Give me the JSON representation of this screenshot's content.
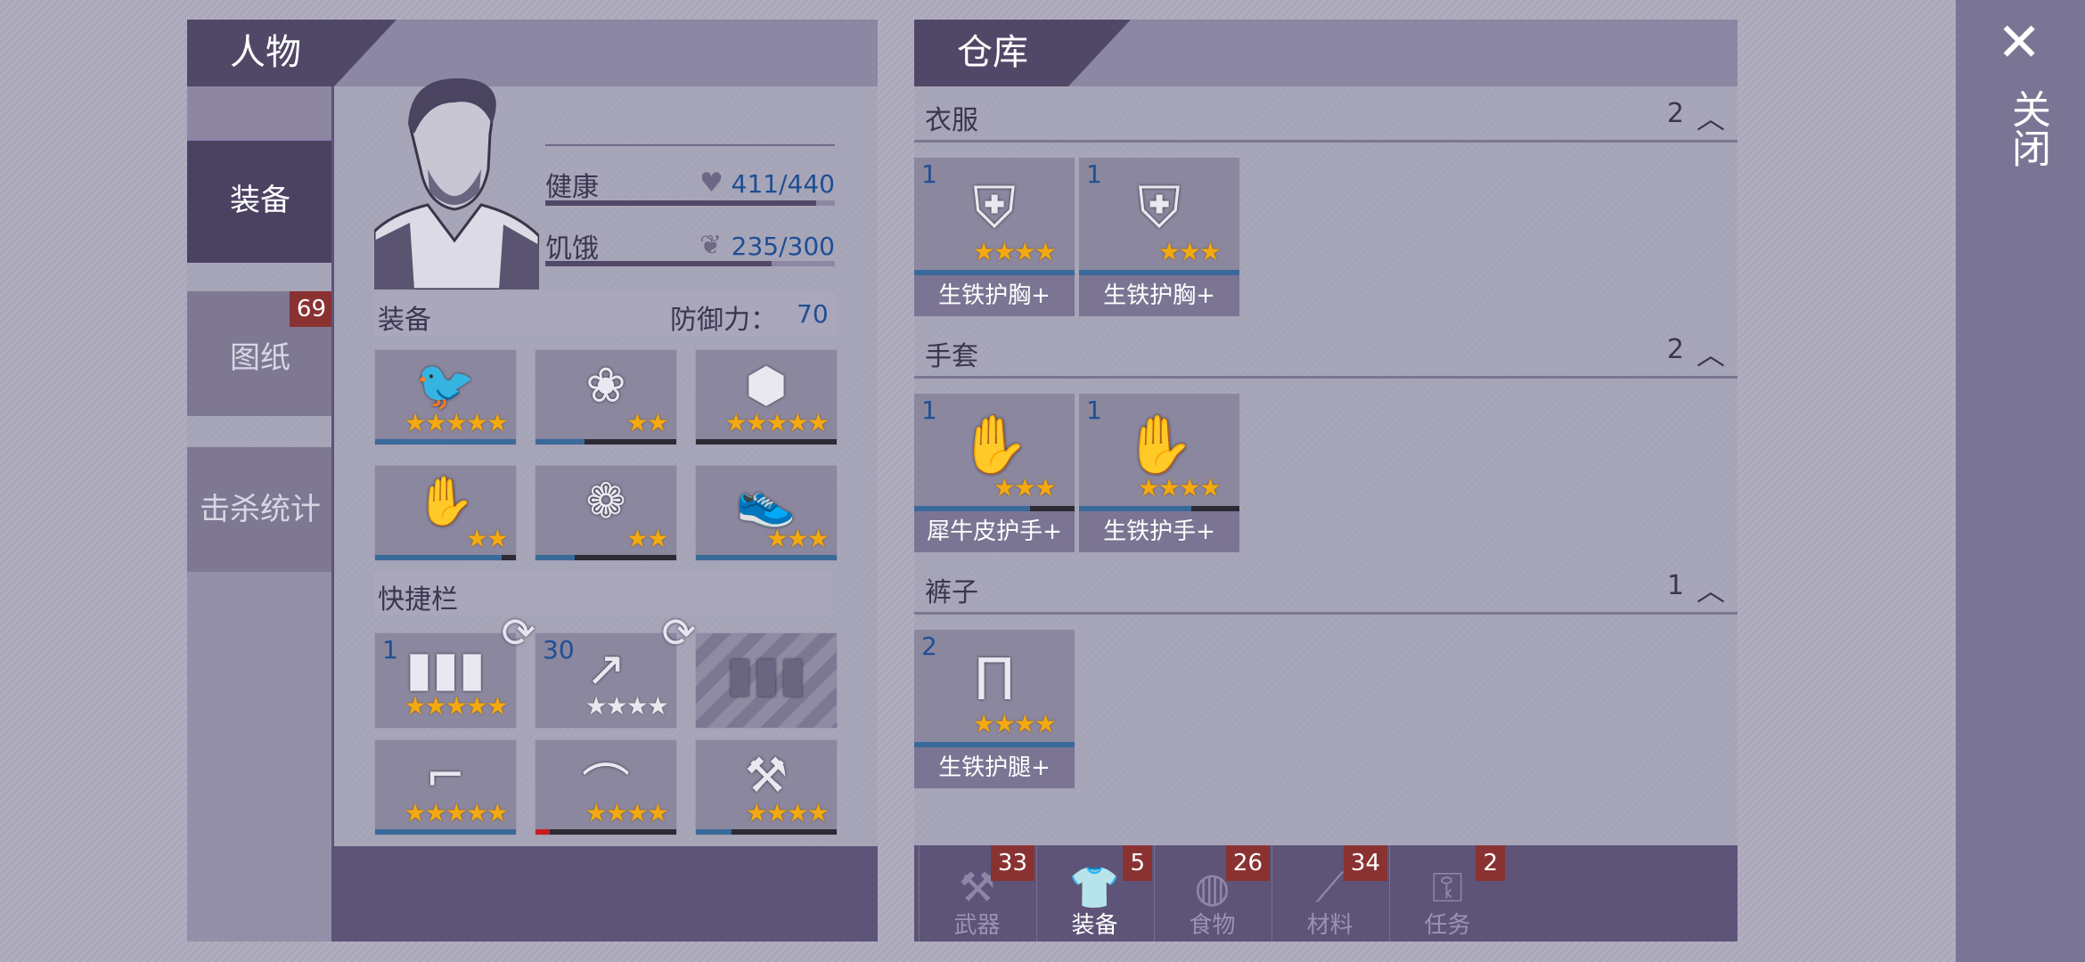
{
  "character_panel": {
    "title": "人物",
    "side_tabs": [
      {
        "label": "装备",
        "active": true
      },
      {
        "label": "图纸",
        "badge": "69"
      },
      {
        "label": "击杀统计"
      }
    ],
    "stats": {
      "health": {
        "label": "健康",
        "value": "411/440",
        "fraction": 0.934,
        "icon": "heart-icon"
      },
      "hunger": {
        "label": "饥饿",
        "value": "235/300",
        "fraction": 0.783,
        "icon": "stomach-icon"
      }
    },
    "equipment": {
      "label": "装备",
      "defense_label": "防御力：",
      "defense_value": "70",
      "slots": [
        {
          "icon": "bird-mask-helmet-icon",
          "stars": 5,
          "durability": 1.0
        },
        {
          "icon": "floral-vest-icon",
          "stars": 2,
          "durability": 0.35
        },
        {
          "icon": "turtle-shell-icon",
          "stars": 5,
          "durability": 0.0
        },
        {
          "icon": "gloves-icon",
          "stars": 2,
          "durability": 0.9
        },
        {
          "icon": "floral-pants-icon",
          "stars": 2,
          "durability": 0.28
        },
        {
          "icon": "sneakers-icon",
          "stars": 3,
          "durability": 1.0
        }
      ]
    },
    "quickbar": {
      "label": "快捷栏",
      "slots": [
        {
          "icon": "bullets-icon",
          "count": "1",
          "stars": 5,
          "swap": true
        },
        {
          "icon": "poison-spear-icon",
          "count": "30",
          "stars": 4,
          "stars_filled": 0,
          "swap": true
        },
        {
          "icon": "empty-ammo-slot-icon",
          "empty": true
        },
        {
          "icon": "revolver-icon",
          "stars": 5,
          "durability": 1.0
        },
        {
          "icon": "bow-icon",
          "stars": 4,
          "durability": 0.1,
          "low": true
        },
        {
          "icon": "axe-icon",
          "stars": 4,
          "durability": 0.25
        }
      ]
    }
  },
  "warehouse": {
    "title": "仓库",
    "categories": [
      {
        "label": "衣服",
        "count": "2",
        "items": [
          {
            "count": "1",
            "name": "生铁护胸+",
            "stars": 4,
            "durability": 1.0,
            "icon": "iron-chestplate-icon"
          },
          {
            "count": "1",
            "name": "生铁护胸+",
            "stars": 3,
            "durability": 1.0,
            "icon": "iron-chestplate-icon"
          }
        ]
      },
      {
        "label": "手套",
        "count": "2",
        "items": [
          {
            "count": "1",
            "name": "犀牛皮护手+",
            "stars": 3,
            "durability": 0.72,
            "icon": "rhino-gloves-icon"
          },
          {
            "count": "1",
            "name": "生铁护手+",
            "stars": 4,
            "durability": 0.7,
            "icon": "iron-gloves-icon"
          }
        ]
      },
      {
        "label": "裤子",
        "count": "1",
        "items": [
          {
            "count": "2",
            "name": "生铁护腿+",
            "stars": 4,
            "durability": 1.0,
            "icon": "iron-leggings-icon"
          }
        ]
      }
    ],
    "bottom_tabs": [
      {
        "label": "武器",
        "badge": "33",
        "icon": "axe-icon",
        "active": false
      },
      {
        "label": "装备",
        "badge": "5",
        "icon": "shirt-icon",
        "active": true
      },
      {
        "label": "食物",
        "badge": "26",
        "icon": "food-icon",
        "active": false
      },
      {
        "label": "材料",
        "badge": "34",
        "icon": "material-icon",
        "active": false
      },
      {
        "label": "任务",
        "badge": "2",
        "icon": "key-icon",
        "active": false
      }
    ]
  },
  "close": {
    "label": "关闭",
    "icon": "close-icon"
  },
  "colors": {
    "star": "#f3a912",
    "durability": "#3a6a9a",
    "badge": "#8a3232",
    "accent": "#4b4262"
  }
}
